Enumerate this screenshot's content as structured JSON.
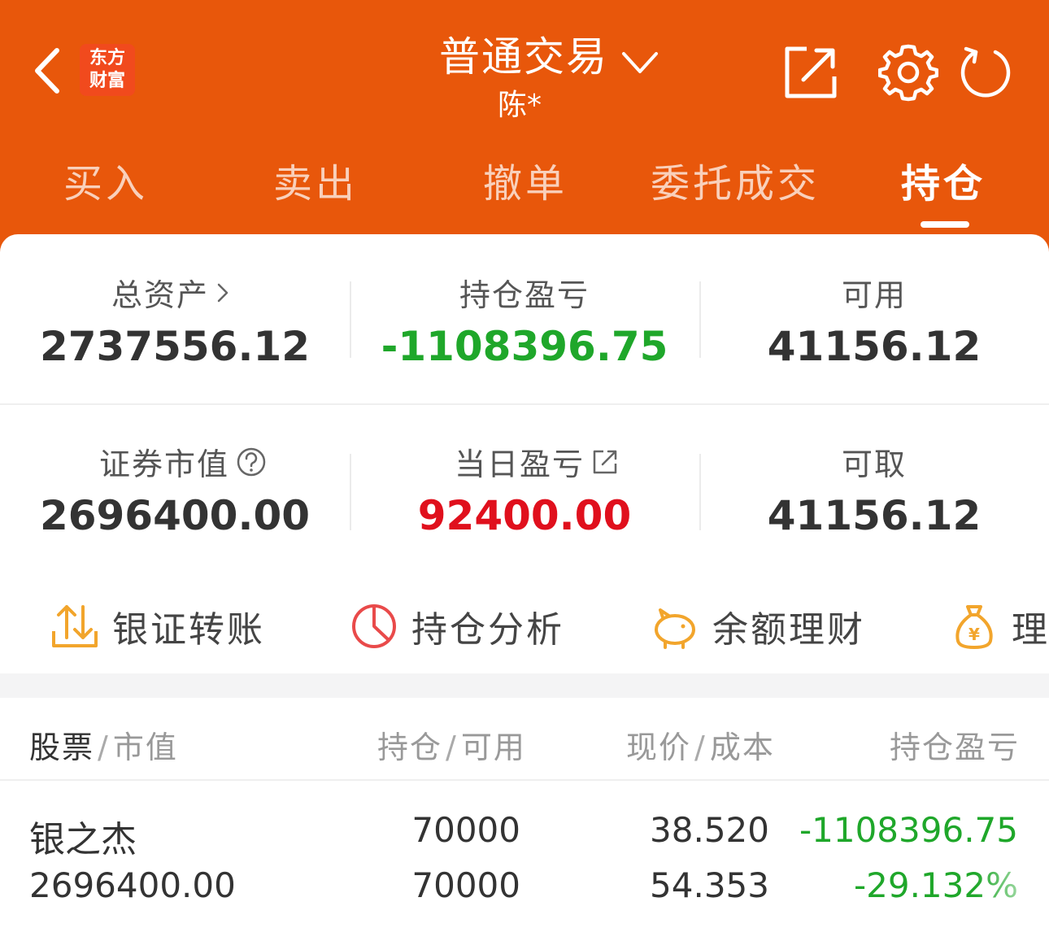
{
  "header": {
    "logo_line1": "东方",
    "logo_line2": "财富",
    "title": "普通交易",
    "account": "陈*"
  },
  "tabs": [
    {
      "label": "买入"
    },
    {
      "label": "卖出"
    },
    {
      "label": "撤单"
    },
    {
      "label": "委托成交"
    },
    {
      "label": "持仓",
      "active": true
    }
  ],
  "summary": {
    "total_assets_label": "总资产",
    "total_assets": "2737556.12",
    "position_pl_label": "持仓盈亏",
    "position_pl": "-1108396.75",
    "available_label": "可用",
    "available": "41156.12",
    "market_value_label": "证券市值",
    "market_value": "2696400.00",
    "daily_pl_label": "当日盈亏",
    "daily_pl": "92400.00",
    "withdrawable_label": "可取",
    "withdrawable": "41156.12"
  },
  "shortcuts": [
    {
      "label": "银证转账",
      "icon": "transfer-icon"
    },
    {
      "label": "持仓分析",
      "icon": "pie-chart-icon"
    },
    {
      "label": "余额理财",
      "icon": "piggy-bank-icon"
    },
    {
      "label": "理财",
      "icon": "money-bag-icon"
    }
  ],
  "table": {
    "col1_a": "股票",
    "col1_b": "市值",
    "col2_a": "持仓",
    "col2_b": "可用",
    "col3_a": "现价",
    "col3_b": "成本",
    "col4": "持仓盈亏",
    "rows": [
      {
        "name": "银之杰",
        "market_value": "2696400.00",
        "position": "70000",
        "available": "70000",
        "price": "38.520",
        "cost": "54.353",
        "pl": "-1108396.75",
        "pl_pct": "-29.132%"
      }
    ]
  },
  "colors": {
    "brand": "#e8570b",
    "loss": "#1fa72a",
    "gain": "#e0101d"
  }
}
